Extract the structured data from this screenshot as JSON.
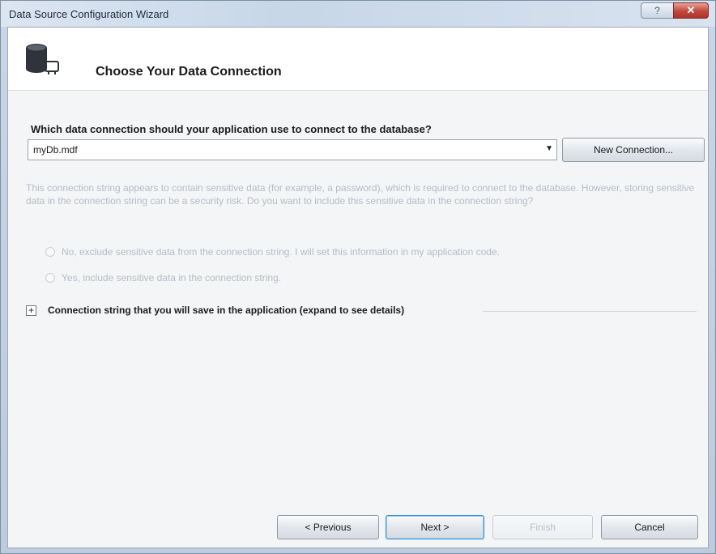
{
  "window": {
    "title": "Data Source Configuration Wizard",
    "help_label": "?",
    "close_label": "✕"
  },
  "header": {
    "title": "Choose Your Data Connection",
    "icon": "database-connection-icon"
  },
  "connection": {
    "question": "Which data connection should your application use to connect to the database?",
    "selected": "myDb.mdf",
    "new_connection_label": "New Connection..."
  },
  "sensitive": {
    "message": "This connection string appears to contain sensitive data (for example, a password), which is required to connect to the database. However, storing sensitive data in the connection string can be a security risk. Do you want to include this sensitive data in the connection string?",
    "option_no": "No, exclude sensitive data from the connection string. I will set this information in my application code.",
    "option_yes": "Yes, include sensitive data in the connection string."
  },
  "expander": {
    "label": "Connection string that you will save in the application (expand to see details)",
    "symbol": "+"
  },
  "footer": {
    "previous_label": "< Previous",
    "next_label": "Next >",
    "finish_label": "Finish",
    "cancel_label": "Cancel"
  },
  "colors": {
    "accent": "#3a8ccf",
    "close_button": "#c2453a",
    "disabled_text": "#b5bcc5"
  }
}
